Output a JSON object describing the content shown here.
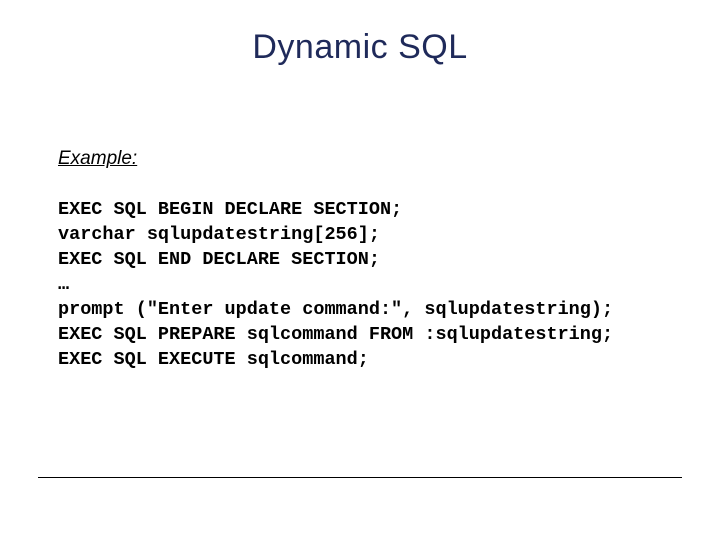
{
  "title": "Dynamic SQL",
  "example_label": "Example:",
  "code": {
    "l1": "EXEC SQL BEGIN DECLARE SECTION;",
    "l2": "varchar sqlupdatestring[256];",
    "l3": "EXEC SQL END DECLARE SECTION;",
    "l4": "…",
    "l5": "prompt (\"Enter update command:\", sqlupdatestring);",
    "l6": "EXEC SQL PREPARE sqlcommand FROM :sqlupdatestring;",
    "l7": "EXEC SQL EXECUTE sqlcommand;"
  }
}
